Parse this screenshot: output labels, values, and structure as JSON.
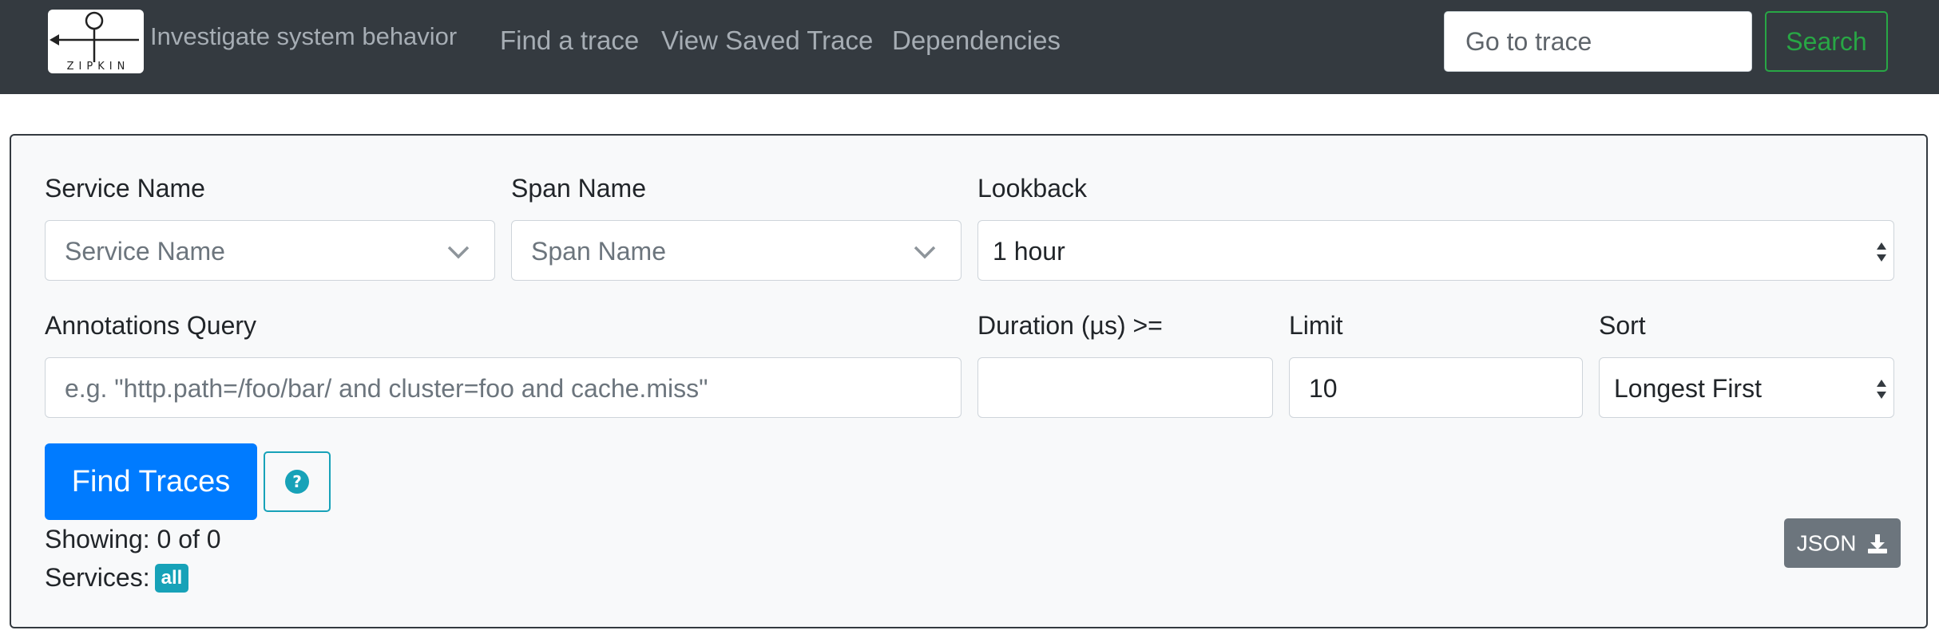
{
  "navbar": {
    "logo_text": "ZIPKIN",
    "tagline": "Investigate system behavior",
    "links": [
      "Find a trace",
      "View Saved Trace",
      "Dependencies"
    ],
    "goto_placeholder": "Go to trace",
    "search_label": "Search"
  },
  "form": {
    "service": {
      "label": "Service Name",
      "placeholder": "Service Name"
    },
    "span": {
      "label": "Span Name",
      "placeholder": "Span Name"
    },
    "lookback": {
      "label": "Lookback",
      "value": "1 hour"
    },
    "annotations": {
      "label": "Annotations Query",
      "placeholder": "e.g. \"http.path=/foo/bar/ and cluster=foo and cache.miss\""
    },
    "duration": {
      "label": "Duration (µs) >=",
      "value": ""
    },
    "limit": {
      "label": "Limit",
      "value": "10"
    },
    "sort": {
      "label": "Sort",
      "value": "Longest First"
    },
    "find_label": "Find Traces",
    "help_icon": "question-circle-icon"
  },
  "results": {
    "showing": "Showing: 0 of 0",
    "services_label": "Services:",
    "services_badge": "all",
    "json_label": "JSON",
    "json_icon": "download-icon"
  },
  "colors": {
    "navbar_bg": "#343a40",
    "primary": "#007bff",
    "success": "#28a745",
    "info": "#17a2b8",
    "secondary": "#6c757d"
  }
}
